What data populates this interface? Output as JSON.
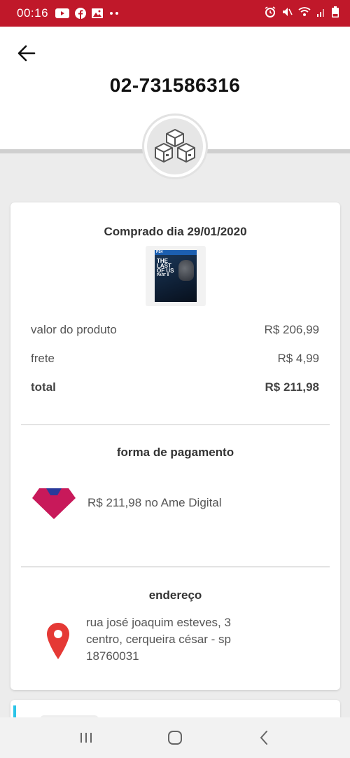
{
  "status_bar": {
    "time": "00:16",
    "left_icons": [
      "youtube-icon",
      "facebook-icon",
      "gallery-icon",
      "more-dots-icon"
    ],
    "right_icons": [
      "alarm-icon",
      "mute-icon",
      "wifi-icon",
      "signal-icon",
      "battery-icon"
    ],
    "background_color": "#c0182a"
  },
  "header": {
    "back_icon": "arrow-left-icon",
    "order_id": "02-731586316",
    "boxes_icon": "boxes-icon"
  },
  "order": {
    "purchase_date": "Comprado dia 29/01/2020",
    "product_image": {
      "platform": "PS4",
      "title_lines": [
        "THE",
        "LAST",
        "OF US",
        "PART II"
      ]
    },
    "lines": [
      {
        "label": "valor do produto",
        "value": "R$ 206,99"
      },
      {
        "label": "frete",
        "value": "R$ 4,99"
      },
      {
        "label": "total",
        "value": "R$ 211,98"
      }
    ]
  },
  "payment": {
    "title": "forma de pagamento",
    "logo_icon": "ame-digital-logo",
    "description": "R$ 211,98 no Ame Digital",
    "logo_colors": {
      "primary": "#c8195a",
      "secondary": "#2a3a9a"
    }
  },
  "address": {
    "title": "endereço",
    "pin_icon": "location-pin-icon",
    "pin_color": "#e53935",
    "lines": [
      "rua josé joaquim esteves, 3",
      "centro, cerqueira césar - sp",
      "18760031"
    ]
  },
  "nav_bar": {
    "buttons": [
      "recent-apps-icon",
      "home-icon",
      "back-nav-icon"
    ]
  }
}
